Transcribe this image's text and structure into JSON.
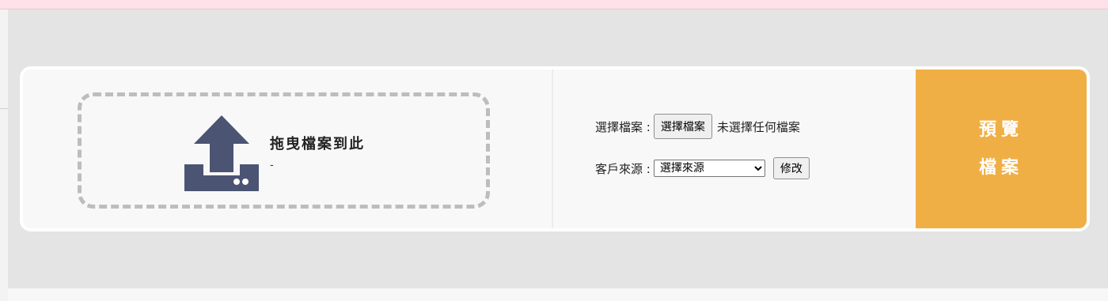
{
  "dropzone": {
    "title": "拖曳檔案到此",
    "subtitle": "-",
    "icon": "upload-icon"
  },
  "form": {
    "file_label": "選擇檔案 :",
    "file_button": "選擇檔案",
    "file_status": "未選擇任何檔案",
    "source_label": "客戶來源 :",
    "source_selected": "選擇來源",
    "modify_button": "修改"
  },
  "preview_button": {
    "line1": "預覽",
    "line2": "檔案"
  },
  "colors": {
    "accent": "#f0af45",
    "icon": "#4b5473",
    "page_background": "#e4e4e4",
    "card_background": "#f8f8f8",
    "top_strip": "#fde0e8"
  }
}
